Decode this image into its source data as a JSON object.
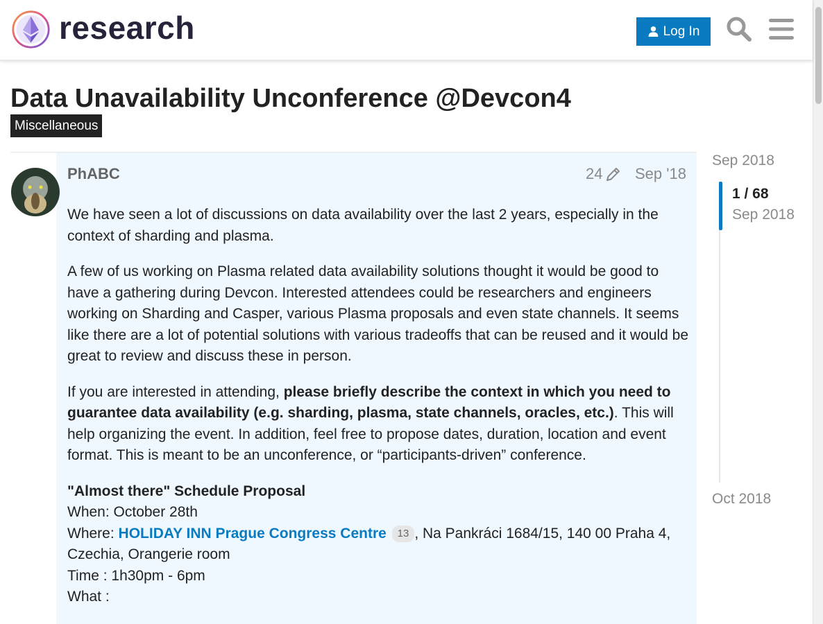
{
  "header": {
    "logo_text": "research",
    "login_label": "Log In"
  },
  "topic": {
    "title": "Data Unavailability Unconference @Devcon4",
    "category": "Miscellaneous"
  },
  "post": {
    "username": "PhABC",
    "edit_count": "24",
    "date": "Sep '18",
    "p1": "We have seen a lot of discussions on data availability over the last 2 years, especially in the context of sharding and plasma.",
    "p2": "A few of us working on Plasma related data availability solutions thought it would be good to have a gathering during Devcon. Interested attendees could be researchers and engineers working on Sharding and Casper, various Plasma proposals and even state channels. It seems like there are a lot of potential solutions with various tradeoffs that can be reused and it would be great to review and discuss these in person.",
    "p3_start": "If you are interested in attending, ",
    "p3_bold": "please briefly describe the context in which you need to guarantee data availability (e.g. sharding, plasma, state channels, oracles, etc.)",
    "p3_end": ". This will help organizing the event. In addition, feel free to propose dates, duration, location and event format. This is meant to be an unconference, or “participants-driven” conference.",
    "schedule_heading": "\"Almost there\" Schedule Proposal",
    "when": "When: October 28th",
    "where_prefix": "Where: ",
    "where_link": "HOLIDAY INN Prague Congress Centre",
    "where_link_clicks": "13",
    "where_suffix": ", Na Pankráci 1684/15, 140 00 Praha 4, Czechia, Orangerie room",
    "time": "Time : 1h30pm - 6pm",
    "what": "What :"
  },
  "timeline": {
    "start_date": "Sep 2018",
    "position": "1 / 68",
    "position_date": "Sep 2018",
    "end_date": "Oct 2018"
  },
  "colors": {
    "accent": "#0a7bc1",
    "post_bg": "#f0f8ff",
    "category_bg": "#222222"
  }
}
